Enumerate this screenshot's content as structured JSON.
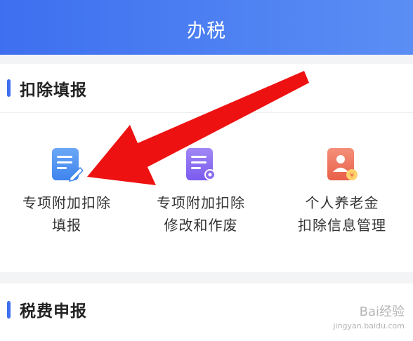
{
  "header": {
    "title": "办税"
  },
  "deduction_section": {
    "title": "扣除填报",
    "items": [
      {
        "line1": "专项附加扣除",
        "line2": "填报",
        "icon": "document-edit-icon",
        "color": "#4c8ff0"
      },
      {
        "line1": "专项附加扣除",
        "line2": "修改和作废",
        "icon": "document-settings-icon",
        "color": "#8a6cf0"
      },
      {
        "line1": "个人养老金",
        "line2": "扣除信息管理",
        "icon": "pension-card-icon",
        "color": "#ee6f59"
      }
    ]
  },
  "tax_section": {
    "title": "税费申报"
  },
  "watermark": {
    "brand": "Bai经验",
    "site": "jingyan.baidu.com"
  },
  "colors": {
    "accent": "#3d6ff0",
    "arrow": "#ee1111"
  }
}
